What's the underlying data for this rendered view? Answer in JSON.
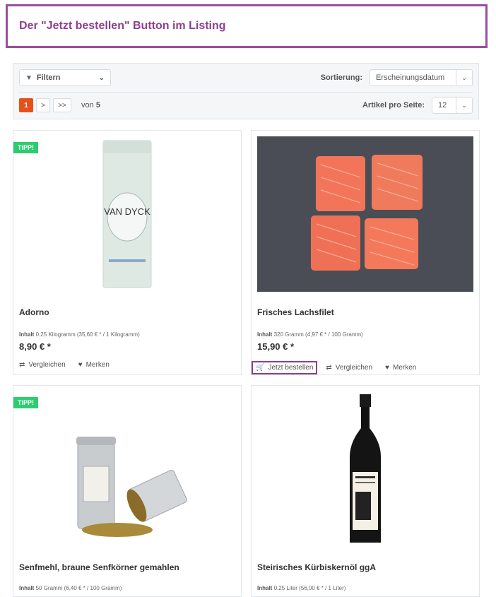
{
  "header": {
    "title": "Der \"Jetzt bestellen\" Button im Listing"
  },
  "toolbar": {
    "filter_label": "Filtern",
    "sort_label": "Sortierung:",
    "sort_value": "Erscheinungsdatum",
    "per_page_label": "Artikel pro Seite:",
    "per_page_value": "12",
    "pager": {
      "current": "1",
      "next": ">",
      "last": ">>",
      "of_label": "von",
      "total": "5"
    }
  },
  "products": [
    {
      "badge": "TIPP!",
      "title": "Adorno",
      "content_label": "Inhalt",
      "content": "0.25 Kilogramm (35,60 € * / 1 Kilogramm)",
      "price": "8,90 € *",
      "compare": "Vergleichen",
      "remember": "Merken",
      "image_text": "VAN DYCK"
    },
    {
      "title": "Frisches Lachsfilet",
      "content_label": "Inhalt",
      "content": "320 Gramm (4,97 € * / 100 Gramm)",
      "price": "15,90 € *",
      "order": "Jetzt bestellen",
      "compare": "Vergleichen",
      "remember": "Merken"
    },
    {
      "badge": "TIPP!",
      "title": "Senfmehl, braune Senfkörner gemahlen",
      "content_label": "Inhalt",
      "content": "50 Gramm (6,40 € * / 100 Gramm)"
    },
    {
      "title": "Steirisches Kürbiskernöl ggA",
      "content_label": "Inhalt",
      "content": "0.25 Liter (56,00 € * / 1 Liter)"
    }
  ],
  "colors": {
    "accent": "#8e3f8e",
    "badge": "#2ecc71",
    "pager_active": "#e8501b"
  }
}
